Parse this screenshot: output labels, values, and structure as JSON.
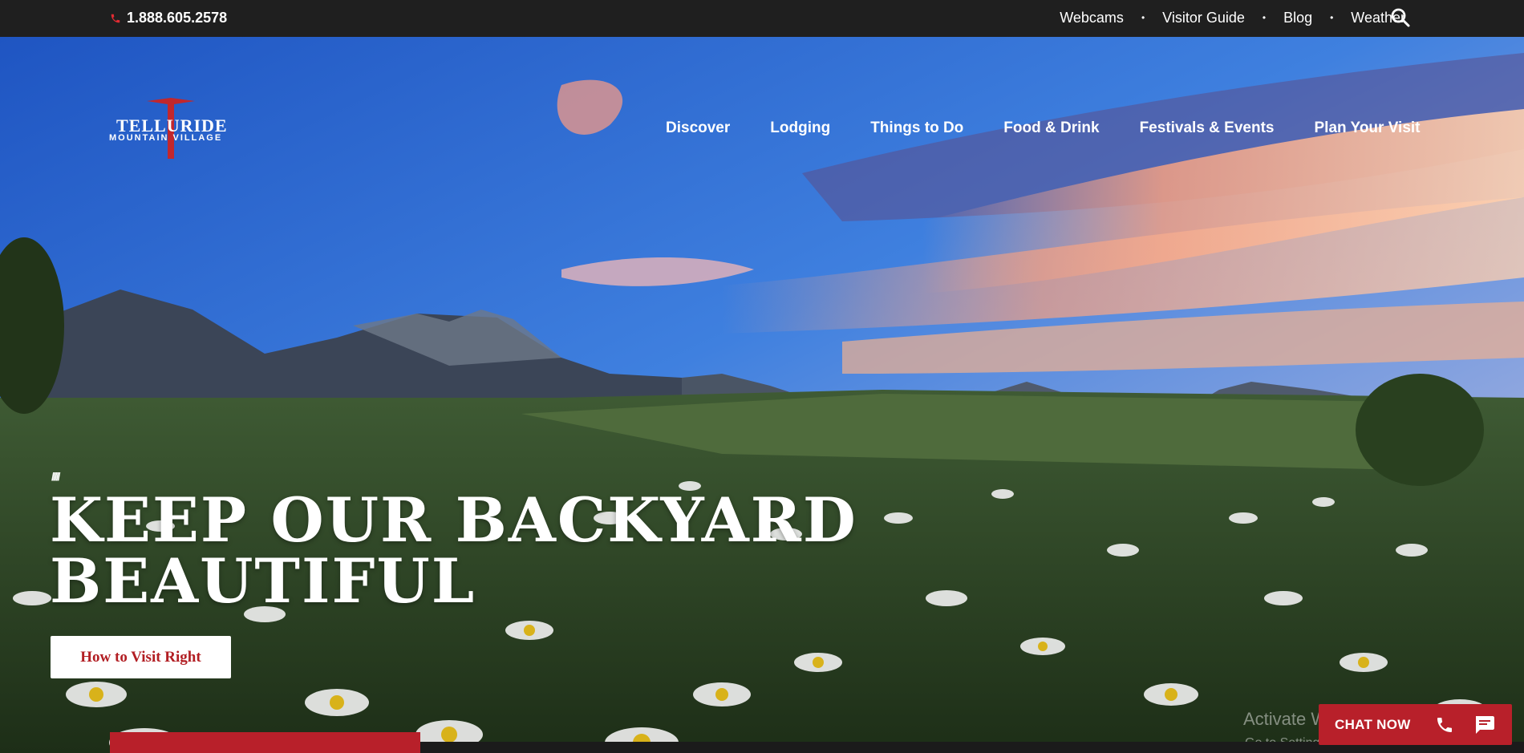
{
  "topbar": {
    "phone": "1.888.605.2578",
    "links": [
      "Webcams",
      "Visitor Guide",
      "Blog",
      "Weather"
    ],
    "separator": "•"
  },
  "logo": {
    "line1": "TELLURIDE",
    "line2": "MOUNTAIN VILLAGE"
  },
  "nav": {
    "items": [
      "Discover",
      "Lodging",
      "Things to Do",
      "Food & Drink",
      "Festivals & Events",
      "Plan Your Visit"
    ]
  },
  "hero": {
    "decor": "/////",
    "headline_line1": "KEEP OUR BACKYARD",
    "headline_line2": "BEAUTIFUL",
    "cta": "How to Visit Right"
  },
  "watermark": {
    "line1": "Activate Windows",
    "line2": "Go to Settings to activate Windows."
  },
  "chat": {
    "label": "CHAT NOW"
  },
  "icons": {
    "phone": "phone-icon",
    "search": "search-icon",
    "chat_phone": "phone-icon",
    "chat_bubble": "chat-bubble-icon"
  },
  "colors": {
    "brand_red": "#b8202a",
    "topbar_bg": "#1f1f1f",
    "cta_text": "#b21e23"
  }
}
